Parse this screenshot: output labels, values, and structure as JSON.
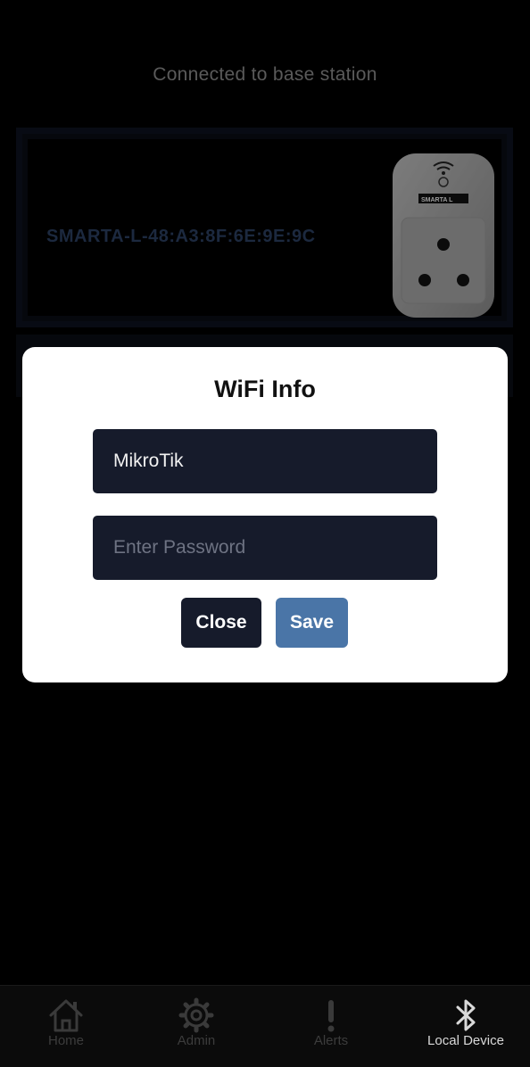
{
  "status": {
    "text": "Connected to base station"
  },
  "device": {
    "id": "SMARTA-L-48:A3:8F:6E:9E:9C",
    "image_label": "SMARTA L"
  },
  "modal": {
    "title": "WiFi Info",
    "ssid_value": "MikroTik",
    "password_placeholder": "Enter Password",
    "close_label": "Close",
    "save_label": "Save"
  },
  "tabbar": {
    "tabs": [
      {
        "label": "Home",
        "icon": "home-icon",
        "active": false
      },
      {
        "label": "Admin",
        "icon": "gear-icon",
        "active": false
      },
      {
        "label": "Alerts",
        "icon": "exclamation-icon",
        "active": false
      },
      {
        "label": "Local Device",
        "icon": "bluetooth-icon",
        "active": true
      }
    ]
  },
  "colors": {
    "background": "#000000",
    "field_bg": "#161b2b",
    "save_button": "#4a75a7",
    "device_id_text": "#2b3f62"
  }
}
